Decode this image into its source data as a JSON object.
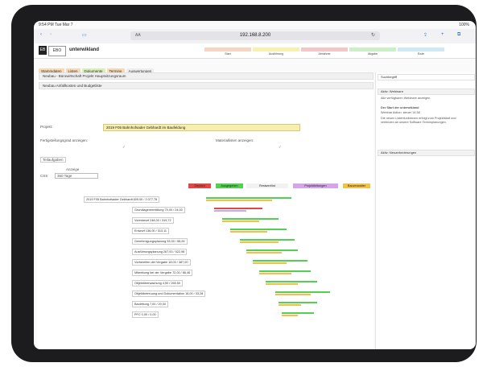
{
  "statusbar": {
    "time": "9:54 PM",
    "date": "Tue Mar 7",
    "battery": "100%"
  },
  "safari": {
    "aa_label": "AA",
    "url": "192.168.8.200",
    "reload": "↻"
  },
  "app": {
    "logo_text": "EB",
    "logo2_text": "EBO",
    "name": "unterwikland",
    "column_colors": [
      "#f6d6c1",
      "#f7f1b0",
      "#f4c6c6",
      "#c9f0c9",
      "#cfe8f6"
    ],
    "column_labels": [
      "Start",
      "Ausführung",
      "Abnahme",
      "Abgabe",
      "Ende"
    ]
  },
  "tabs": [
    {
      "label": "Stammdaten",
      "color": "#f8d9b4"
    },
    {
      "label": "Listen",
      "color": "#f8d9b4"
    },
    {
      "label": "Dokumente",
      "color": "#d8f0b8"
    },
    {
      "label": "Termine",
      "color": "#f8d9b4"
    },
    {
      "label": "Auswertungen",
      "color": "#eeeeee"
    }
  ],
  "sections": {
    "row1": "Neubau - Bürowirtschaft Projekt Hauptsitzungsraum",
    "row2": "Neubau Anfallkosten und Budgetliste"
  },
  "form": {
    "projekt_label": "Projekt:",
    "projekt_value": "2019 F05 Bahnhofsader Gebhardt im Baufeldung",
    "opt1_label": "Fertigstellungsgrad anzeigen:",
    "opt2_label": "Materiallisten anzeigen:",
    "teilaufgaben_label": "Teilaufgaben",
    "anzeige_label": "Anzeige",
    "rows_label": "CSS",
    "rows_value": "360 Tage"
  },
  "legend": [
    {
      "label": "Geplant",
      "color": "#e04848"
    },
    {
      "label": "Ausgegeben",
      "color": "#52d052"
    },
    {
      "label": "Restwert/Ist",
      "color": "#f2f2f2"
    },
    {
      "label": "Projektleitungen",
      "color": "#d4a6e8"
    },
    {
      "label": "Bauverwalter",
      "color": "#f0c24a"
    }
  ],
  "gantt": [
    {
      "label": "2019 F05 Bahnhofsader Gebhardt   609,00 / 2.077,78"
    },
    {
      "label": "Grundlagenermittlung   79,00 / 24,00"
    },
    {
      "label": "Vorentwurf   248,00 / 319,72"
    },
    {
      "label": "Entwurf   136,00 / 313,11"
    },
    {
      "label": "Genehmigungsplanung   53,00 / 56,26"
    },
    {
      "label": "Ausführungsplanung   267,00 / 522,98"
    },
    {
      "label": "Vorbereiten der Vergabe   18,00 / 387,00"
    },
    {
      "label": "Mitwirkung bei der Vergabe   72,00 / 86,46"
    },
    {
      "label": "Objektüberwachung   4,50 / 265,50"
    },
    {
      "label": "Objektbetreuung und Dokumentation   18,00 / 33,28"
    },
    {
      "label": "Bauleitung   7,00 / 20,00"
    },
    {
      "label": "PFC   0,00 / 0,00"
    }
  ],
  "gantt_bars": [
    [
      {
        "c": "#52d052",
        "s": 0.05,
        "e": 0.58
      },
      {
        "c": "#f0c24a",
        "s": 0.05,
        "e": 0.46
      }
    ],
    [
      {
        "c": "#e04848",
        "s": 0.1,
        "e": 0.4
      },
      {
        "c": "#d4a6e8",
        "s": 0.1,
        "e": 0.3
      }
    ],
    [
      {
        "c": "#52d052",
        "s": 0.15,
        "e": 0.5
      },
      {
        "c": "#f0c24a",
        "s": 0.15,
        "e": 0.38
      }
    ],
    [
      {
        "c": "#52d052",
        "s": 0.2,
        "e": 0.55
      },
      {
        "c": "#f0c24a",
        "s": 0.2,
        "e": 0.43
      }
    ],
    [
      {
        "c": "#52d052",
        "s": 0.26,
        "e": 0.6
      },
      {
        "c": "#f0c24a",
        "s": 0.26,
        "e": 0.5
      }
    ],
    [
      {
        "c": "#52d052",
        "s": 0.3,
        "e": 0.62
      },
      {
        "c": "#f0c24a",
        "s": 0.3,
        "e": 0.52
      }
    ],
    [
      {
        "c": "#52d052",
        "s": 0.34,
        "e": 0.68
      },
      {
        "c": "#f0c24a",
        "s": 0.34,
        "e": 0.55
      }
    ],
    [
      {
        "c": "#52d052",
        "s": 0.38,
        "e": 0.7
      },
      {
        "c": "#f0c24a",
        "s": 0.38,
        "e": 0.58
      }
    ],
    [
      {
        "c": "#52d052",
        "s": 0.42,
        "e": 0.74
      },
      {
        "c": "#f0c24a",
        "s": 0.42,
        "e": 0.62
      }
    ],
    [
      {
        "c": "#52d052",
        "s": 0.48,
        "e": 0.82
      },
      {
        "c": "#f0c24a",
        "s": 0.48,
        "e": 0.7
      }
    ],
    [
      {
        "c": "#52d052",
        "s": 0.5,
        "e": 0.74
      },
      {
        "c": "#f0c24a",
        "s": 0.5,
        "e": 0.64
      }
    ],
    [
      {
        "c": "#52d052",
        "s": 0.52,
        "e": 0.72
      },
      {
        "c": "#f0c24a",
        "s": 0.52,
        "e": 0.62
      }
    ]
  ],
  "sidebar": {
    "search_placeholder": "Suchbegriff",
    "box1_title": "Aktiv: Webinare",
    "box1_check": "Alle verfügbaren Webinare anzeigen",
    "box1_text1": "Der Start der unterwikland",
    "box1_text2": "Webinar Aktion: steuer 14.58",
    "box1_text3": "Die neuen Listenfunktionen erfolgt zum Projektstart und verbinden an unsere Software Terminplanungen.",
    "box2_title": "Aktiv: Neuanforderungen"
  }
}
